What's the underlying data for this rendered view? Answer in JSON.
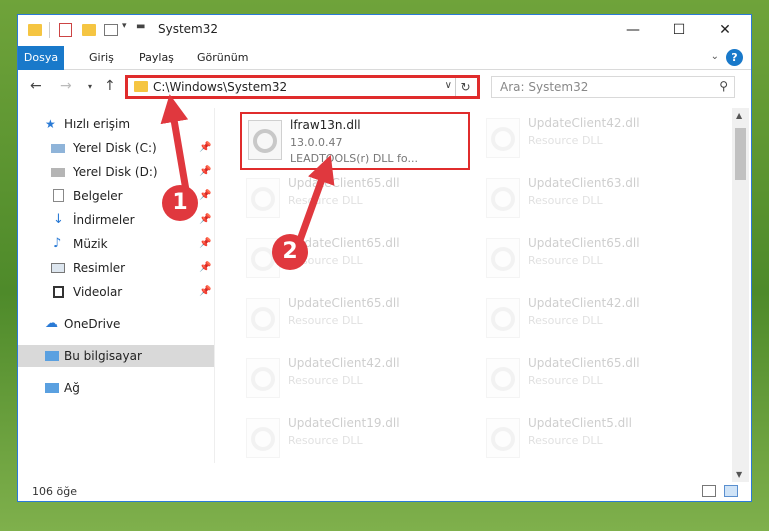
{
  "window": {
    "title": "System32",
    "icons": [
      "folder-icon",
      "properties-icon",
      "new-folder-icon",
      "customize-icon"
    ]
  },
  "ribbon": {
    "tabs": [
      "Dosya",
      "Giriş",
      "Paylaş",
      "Görünüm"
    ],
    "active_tab": "Dosya",
    "help_label": "?"
  },
  "nav": {
    "address": "C:\\Windows\\System32",
    "search_placeholder": "Ara: System32"
  },
  "sidebar": {
    "items": [
      {
        "label": "Hızlı erişim",
        "icon": "star-icon"
      },
      {
        "label": "Yerel Disk (C:)",
        "icon": "drive-icon",
        "pinned": true
      },
      {
        "label": "Yerel Disk (D:)",
        "icon": "drive-icon",
        "pinned": true
      },
      {
        "label": "Belgeler",
        "icon": "documents-icon",
        "pinned": true
      },
      {
        "label": "İndirmeler",
        "icon": "downloads-icon",
        "pinned": true
      },
      {
        "label": "Müzik",
        "icon": "music-icon",
        "pinned": true
      },
      {
        "label": "Resimler",
        "icon": "pictures-icon",
        "pinned": true
      },
      {
        "label": "Videolar",
        "icon": "videos-icon",
        "pinned": true
      },
      {
        "label": "OneDrive",
        "icon": "cloud-icon"
      },
      {
        "label": "Bu bilgisayar",
        "icon": "computer-icon",
        "selected": true
      },
      {
        "label": "Ağ",
        "icon": "network-icon"
      }
    ]
  },
  "files": [
    {
      "name": "lfraw13n.dll",
      "line1": "13.0.0.47",
      "line2": "LEADTOOLS(r) DLL fo...",
      "highlighted": true
    },
    {
      "name": "UpdateClient42.dll",
      "line1": "Resource DLL"
    },
    {
      "name": "UpdateClient65.dll",
      "line1": "Resource DLL"
    },
    {
      "name": "UpdateClient63.dll",
      "line1": "Resource DLL"
    },
    {
      "name": "UpdateClient65.dll",
      "line1": "Resource DLL"
    },
    {
      "name": "UpdateClient65.dll",
      "line1": "Resource DLL"
    },
    {
      "name": "UpdateClient65.dll",
      "line1": "Resource DLL"
    },
    {
      "name": "UpdateClient42.dll",
      "line1": "Resource DLL"
    },
    {
      "name": "UpdateClient42.dll",
      "line1": "Resource DLL"
    },
    {
      "name": "UpdateClient65.dll",
      "line1": "Resource DLL"
    },
    {
      "name": "UpdateClient19.dll",
      "line1": "Resource DLL"
    },
    {
      "name": "UpdateClient5.dll",
      "line1": "Resource DLL"
    }
  ],
  "status": {
    "count": "106 öğe"
  },
  "annotations": {
    "step1": "1",
    "step2": "2",
    "color": "#e0383e"
  }
}
